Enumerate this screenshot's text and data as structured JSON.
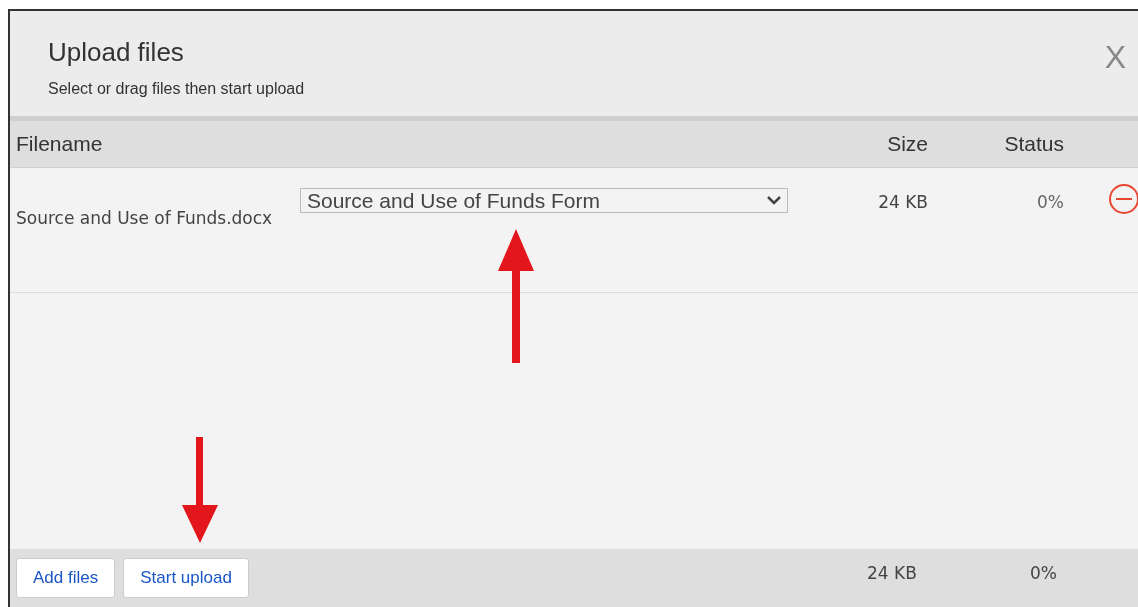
{
  "dialog": {
    "title": "Upload files",
    "subtitle": "Select or drag files then start upload",
    "close": "X"
  },
  "table": {
    "columns": [
      "Filename",
      "Size",
      "Status"
    ],
    "rows": [
      {
        "filename": "Source and Use of Funds.docx",
        "document_type": "Source and Use of Funds Form",
        "size": "24 KB",
        "status": "0%"
      }
    ]
  },
  "footer": {
    "buttons": [
      "Add files",
      "Start upload"
    ],
    "total_size": "24 KB",
    "total_status": "0%"
  }
}
